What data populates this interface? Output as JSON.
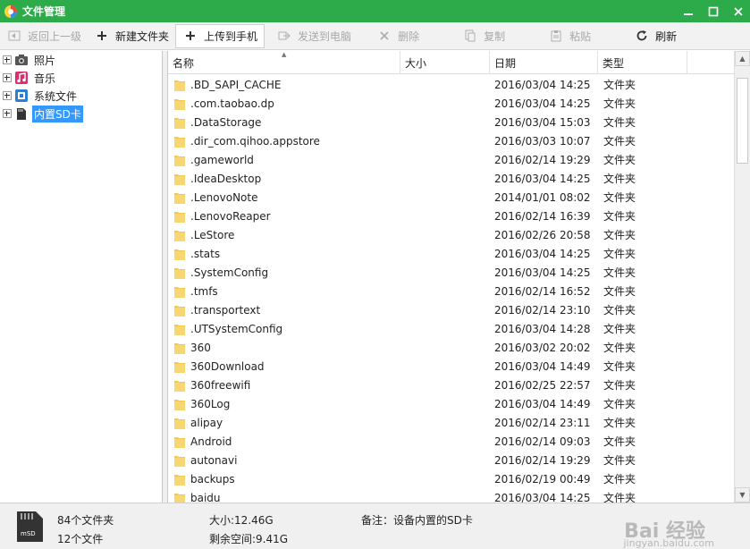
{
  "window": {
    "title": "文件管理",
    "controls": [
      "minimize-icon",
      "maximize-icon",
      "close-icon"
    ]
  },
  "toolbar": {
    "back": "返回上一级",
    "new_folder": "新建文件夹",
    "upload": "上传到手机",
    "send_pc": "发送到电脑",
    "delete": "删除",
    "copy": "复制",
    "paste": "粘贴",
    "refresh": "刷新"
  },
  "tree": {
    "items": [
      {
        "label": "照片",
        "icon": "camera-icon"
      },
      {
        "label": "音乐",
        "icon": "music-icon"
      },
      {
        "label": "系统文件",
        "icon": "system-file-icon"
      },
      {
        "label": "内置SD卡",
        "icon": "sd-card-icon",
        "selected": true
      }
    ]
  },
  "list": {
    "columns": {
      "name": "名称",
      "size": "大小",
      "date": "日期",
      "type": "类型"
    },
    "rows": [
      {
        "name": ".BD_SAPI_CACHE",
        "size": "",
        "date": "2016/03/04 14:25",
        "type": "文件夹"
      },
      {
        "name": ".com.taobao.dp",
        "size": "",
        "date": "2016/03/04 14:25",
        "type": "文件夹"
      },
      {
        "name": ".DataStorage",
        "size": "",
        "date": "2016/03/04 15:03",
        "type": "文件夹"
      },
      {
        "name": ".dir_com.qihoo.appstore",
        "size": "",
        "date": "2016/03/03 10:07",
        "type": "文件夹"
      },
      {
        "name": ".gameworld",
        "size": "",
        "date": "2016/02/14 19:29",
        "type": "文件夹"
      },
      {
        "name": ".IdeaDesktop",
        "size": "",
        "date": "2016/03/04 14:25",
        "type": "文件夹"
      },
      {
        "name": ".LenovoNote",
        "size": "",
        "date": "2014/01/01 08:02",
        "type": "文件夹"
      },
      {
        "name": ".LenovoReaper",
        "size": "",
        "date": "2016/02/14 16:39",
        "type": "文件夹"
      },
      {
        "name": ".LeStore",
        "size": "",
        "date": "2016/02/26 20:58",
        "type": "文件夹"
      },
      {
        "name": ".stats",
        "size": "",
        "date": "2016/03/04 14:25",
        "type": "文件夹"
      },
      {
        "name": ".SystemConfig",
        "size": "",
        "date": "2016/03/04 14:25",
        "type": "文件夹"
      },
      {
        "name": ".tmfs",
        "size": "",
        "date": "2016/02/14 16:52",
        "type": "文件夹"
      },
      {
        "name": ".transportext",
        "size": "",
        "date": "2016/02/14 23:10",
        "type": "文件夹"
      },
      {
        "name": ".UTSystemConfig",
        "size": "",
        "date": "2016/03/04 14:28",
        "type": "文件夹"
      },
      {
        "name": "360",
        "size": "",
        "date": "2016/03/02 20:02",
        "type": "文件夹"
      },
      {
        "name": "360Download",
        "size": "",
        "date": "2016/03/04 14:49",
        "type": "文件夹"
      },
      {
        "name": "360freewifi",
        "size": "",
        "date": "2016/02/25 22:57",
        "type": "文件夹"
      },
      {
        "name": "360Log",
        "size": "",
        "date": "2016/03/04 14:49",
        "type": "文件夹"
      },
      {
        "name": "alipay",
        "size": "",
        "date": "2016/02/14 23:11",
        "type": "文件夹"
      },
      {
        "name": "Android",
        "size": "",
        "date": "2016/02/14 09:03",
        "type": "文件夹"
      },
      {
        "name": "autonavi",
        "size": "",
        "date": "2016/02/14 19:29",
        "type": "文件夹"
      },
      {
        "name": "backups",
        "size": "",
        "date": "2016/02/19 00:49",
        "type": "文件夹"
      },
      {
        "name": "baidu",
        "size": "",
        "date": "2016/03/04 14:25",
        "type": "文件夹"
      }
    ]
  },
  "status": {
    "folders": "84个文件夹",
    "files": "12个文件",
    "size": "大小:12.46G",
    "free": "剩余空间:9.41G",
    "note": "备注：设备内置的SD卡"
  },
  "watermark": {
    "text": "Bai 经验",
    "url": "jingyan.baidu.com"
  },
  "colors": {
    "titlebar": "#2daa4a",
    "selection": "#3399ff",
    "folder": "#f2c94c"
  }
}
